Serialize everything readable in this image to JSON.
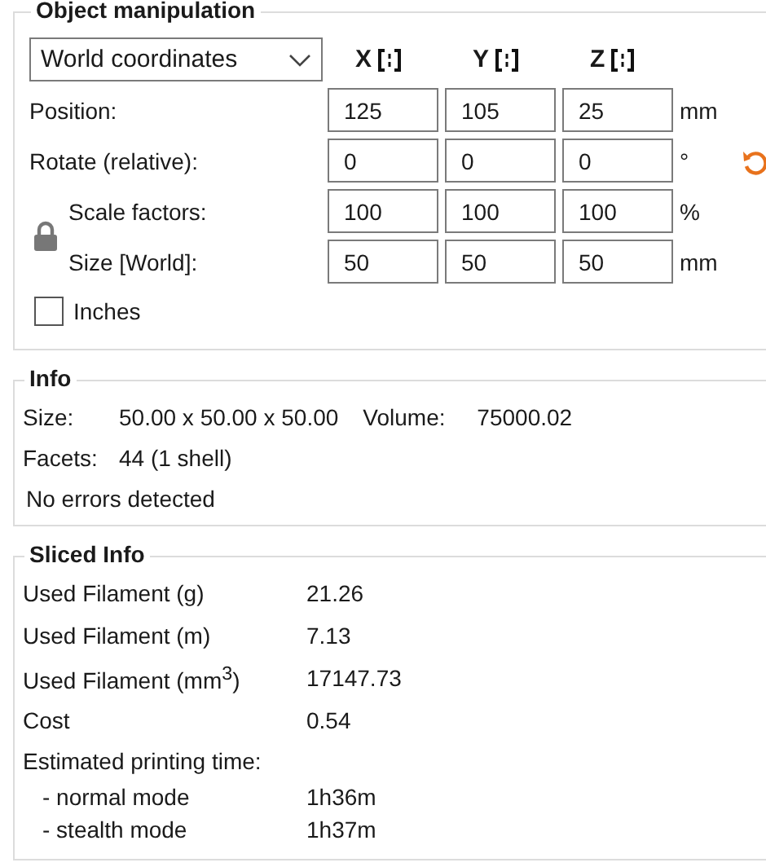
{
  "object_manipulation": {
    "title": "Object manipulation",
    "coordinate_system": "World coordinates",
    "axes": [
      {
        "label": "X"
      },
      {
        "label": "Y"
      },
      {
        "label": "Z"
      }
    ],
    "locked": true,
    "rows": [
      {
        "label": "Position:",
        "values": [
          "125",
          "105",
          "25"
        ],
        "unit": "mm",
        "in_lock": false,
        "reset": false
      },
      {
        "label": "Rotate (relative):",
        "values": [
          "0",
          "0",
          "0"
        ],
        "unit": "°",
        "in_lock": false,
        "reset": true
      },
      {
        "label": "Scale factors:",
        "values": [
          "100",
          "100",
          "100"
        ],
        "unit": "%",
        "in_lock": true,
        "reset": false
      },
      {
        "label": "Size [World]:",
        "values": [
          "50",
          "50",
          "50"
        ],
        "unit": "mm",
        "in_lock": true,
        "reset": false
      }
    ],
    "inches": {
      "label": "Inches",
      "checked": false
    }
  },
  "info": {
    "title": "Info",
    "rows": [
      [
        {
          "label": "Size:",
          "value": "50.00 x 50.00 x 50.00"
        },
        {
          "label": "Volume:",
          "value": "75000.02"
        }
      ],
      [
        {
          "label": "Facets:",
          "value": "44 (1 shell)"
        }
      ]
    ],
    "status": "No errors detected"
  },
  "sliced_info": {
    "title": "Sliced Info",
    "rows": [
      {
        "kind": "stat",
        "label": "Used Filament (g)",
        "value": "21.26"
      },
      {
        "kind": "stat",
        "label": "Used Filament (m)",
        "value": "7.13"
      },
      {
        "kind": "stat",
        "label": "Used Filament (mm$^{3}$)",
        "value": "17147.73"
      },
      {
        "kind": "stat",
        "label": "Cost",
        "value": "0.54"
      },
      {
        "kind": "heading",
        "label": "Estimated printing time:"
      },
      {
        "kind": "sub",
        "label": "- normal mode",
        "value": "1h36m"
      },
      {
        "kind": "sub",
        "label": "- stealth mode",
        "value": "1h37m"
      }
    ]
  }
}
